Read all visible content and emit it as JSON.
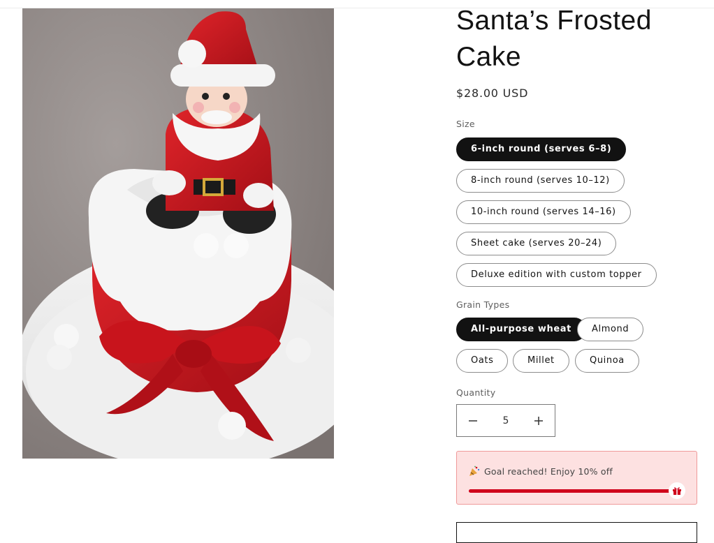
{
  "product": {
    "title": "Santa’s Frosted Cake",
    "price": "$28.00 USD"
  },
  "size": {
    "label": "Size",
    "options": [
      "6-inch round (serves 6–8)",
      "8-inch round (serves 10–12)",
      "10-inch round (serves 14–16)",
      "Sheet cake (serves 20–24)",
      "Deluxe edition with custom topper"
    ],
    "selected": "6-inch round (serves 6–8)"
  },
  "grain": {
    "label": "Grain Types",
    "options": [
      "All-purpose wheat",
      "Almond",
      "Oats",
      "Millet",
      "Quinoa"
    ],
    "selected": "All-purpose wheat"
  },
  "quantity": {
    "label": "Quantity",
    "value": "5",
    "decrease_icon": "minus-icon",
    "increase_icon": "plus-icon"
  },
  "goal_bar": {
    "text": "Goal reached! Enjoy 10% off",
    "progress": 1.0,
    "icon": "party-popper-icon",
    "reward_icon": "gift-icon",
    "fill_color": "#d0021b",
    "background_color": "#fde1e1"
  },
  "colors": {
    "selected_pill": "#121212",
    "pill_border": "#8c8c8c"
  }
}
